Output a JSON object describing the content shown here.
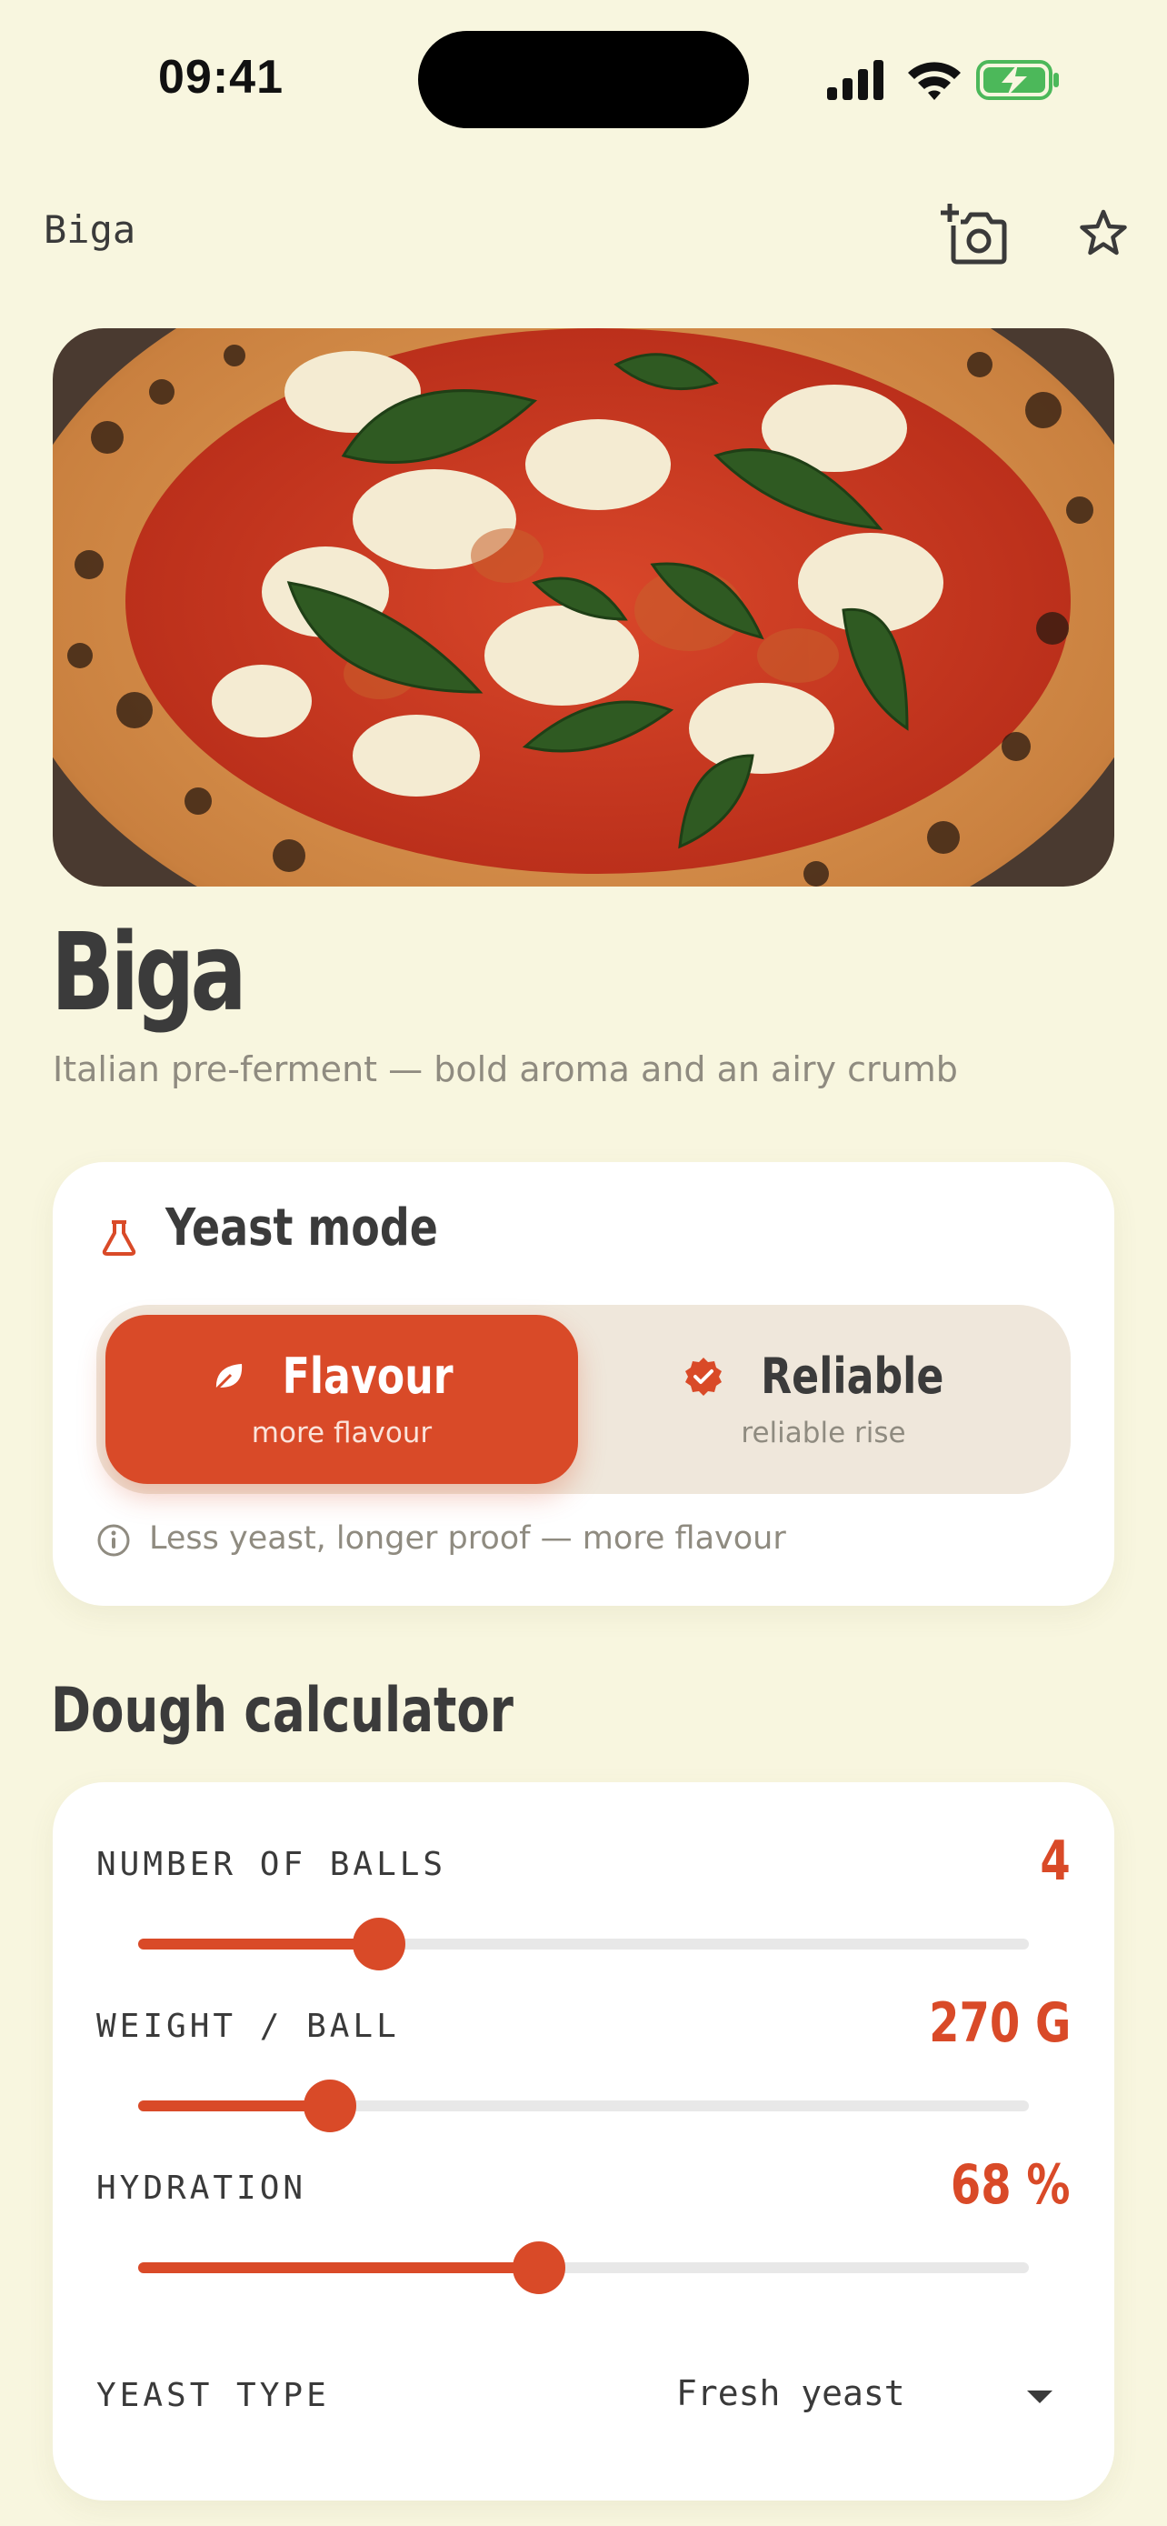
{
  "status_bar": {
    "time": "09:41"
  },
  "topbar": {
    "title": "Biga",
    "icons": [
      "add-photo-icon",
      "star-icon"
    ]
  },
  "recipe": {
    "title": "Biga",
    "subtitle": "Italian pre-ferment — bold aroma and an airy crumb"
  },
  "yeast_mode": {
    "heading": "Yeast mode",
    "options": [
      {
        "label": "Flavour",
        "sub": "more flavour",
        "icon": "leaf-icon",
        "selected": true
      },
      {
        "label": "Reliable",
        "sub": "reliable rise",
        "icon": "verified-badge-icon",
        "selected": false
      }
    ],
    "hint": "Less yeast, longer proof — more flavour"
  },
  "calculator": {
    "title": "Dough calculator",
    "sliders": [
      {
        "label": "NUMBER OF BALLS",
        "value": "4",
        "fraction": 0.27
      },
      {
        "label": "WEIGHT / BALL",
        "value": "270 G",
        "fraction": 0.215
      },
      {
        "label": "HYDRATION",
        "value": "68 %",
        "fraction": 0.45
      }
    ],
    "yeast_type": {
      "label": "YEAST TYPE",
      "value": "Fresh yeast"
    }
  },
  "colors": {
    "background": "#F8F6DF",
    "accent": "#D94A28",
    "card": "#FFFFFF",
    "segment_bg": "#EFE7DB"
  }
}
